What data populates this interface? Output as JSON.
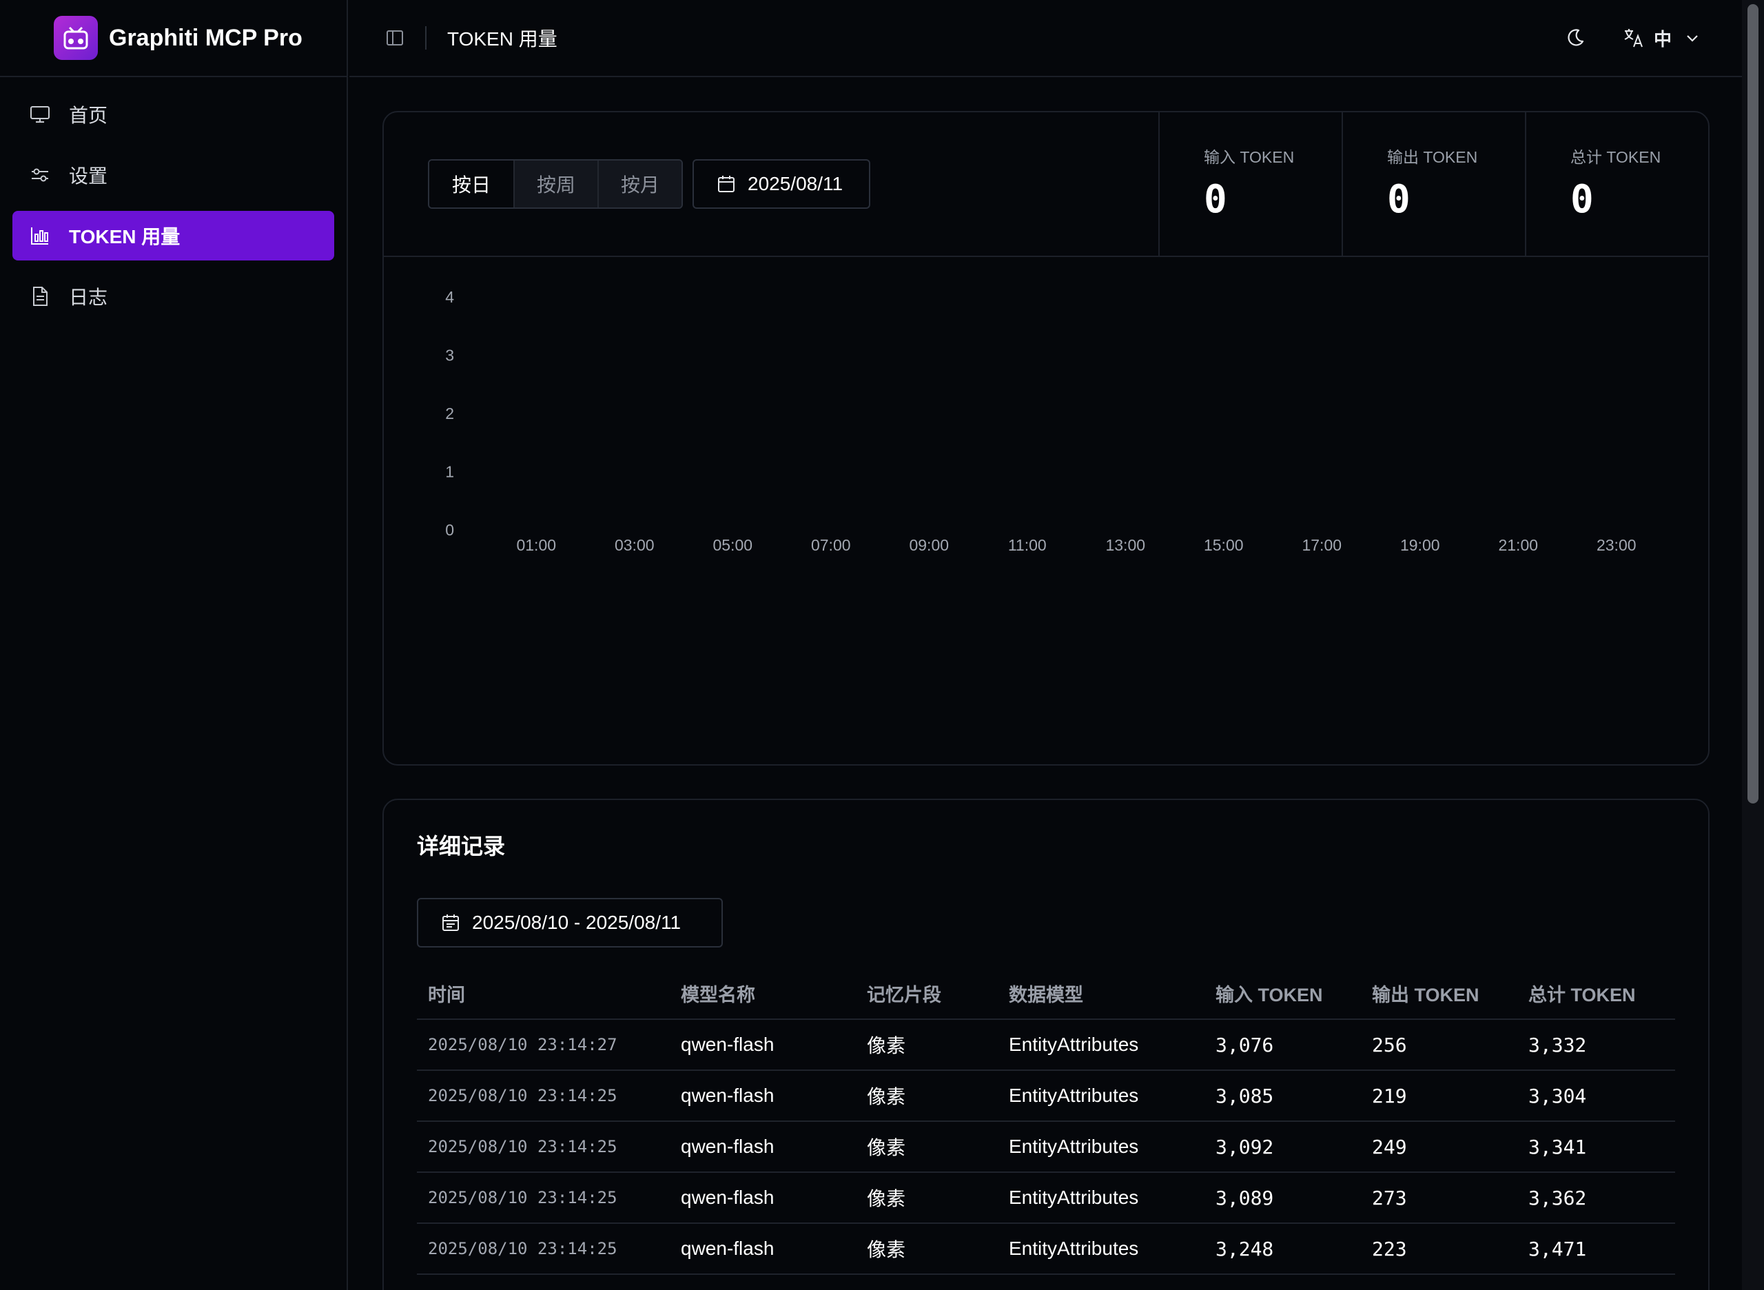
{
  "app": {
    "title": "Graphiti MCP Pro"
  },
  "sidebar": {
    "items": [
      {
        "label": "首页",
        "icon": "monitor-icon",
        "active": false
      },
      {
        "label": "设置",
        "icon": "sliders-icon",
        "active": false
      },
      {
        "label": "TOKEN 用量",
        "icon": "bar-chart-icon",
        "active": true
      },
      {
        "label": "日志",
        "icon": "file-text-icon",
        "active": false
      }
    ]
  },
  "header": {
    "title": "TOKEN 用量",
    "language": "中",
    "icons": [
      "sidebar-toggle-icon",
      "moon-icon",
      "translate-icon",
      "chevron-down-icon"
    ]
  },
  "controls": {
    "period_buttons": [
      "按日",
      "按周",
      "按月"
    ],
    "selected_period": "按日",
    "date": "2025/08/11"
  },
  "stats": [
    {
      "label": "输入 TOKEN",
      "value": "0"
    },
    {
      "label": "输出 TOKEN",
      "value": "0"
    },
    {
      "label": "总计 TOKEN",
      "value": "0"
    }
  ],
  "chart_data": {
    "type": "bar",
    "categories": [
      "01:00",
      "03:00",
      "05:00",
      "07:00",
      "09:00",
      "11:00",
      "13:00",
      "15:00",
      "17:00",
      "19:00",
      "21:00",
      "23:00"
    ],
    "values": [
      0,
      0,
      0,
      0,
      0,
      0,
      0,
      0,
      0,
      0,
      0,
      0
    ],
    "yticks": [
      "0",
      "1",
      "2",
      "3",
      "4"
    ],
    "ylim": [
      0,
      4
    ],
    "grid": false
  },
  "records": {
    "title": "详细记录",
    "date_range": "2025/08/10 - 2025/08/11",
    "columns": [
      "时间",
      "模型名称",
      "记忆片段",
      "数据模型",
      "输入 TOKEN",
      "输出 TOKEN",
      "总计 TOKEN"
    ],
    "rows": [
      [
        "2025/08/10 23:14:27",
        "qwen-flash",
        "像素",
        "EntityAttributes",
        "3,076",
        "256",
        "3,332"
      ],
      [
        "2025/08/10 23:14:25",
        "qwen-flash",
        "像素",
        "EntityAttributes",
        "3,085",
        "219",
        "3,304"
      ],
      [
        "2025/08/10 23:14:25",
        "qwen-flash",
        "像素",
        "EntityAttributes",
        "3,092",
        "249",
        "3,341"
      ],
      [
        "2025/08/10 23:14:25",
        "qwen-flash",
        "像素",
        "EntityAttributes",
        "3,089",
        "273",
        "3,362"
      ],
      [
        "2025/08/10 23:14:25",
        "qwen-flash",
        "像素",
        "EntityAttributes",
        "3,248",
        "223",
        "3,471"
      ]
    ]
  }
}
